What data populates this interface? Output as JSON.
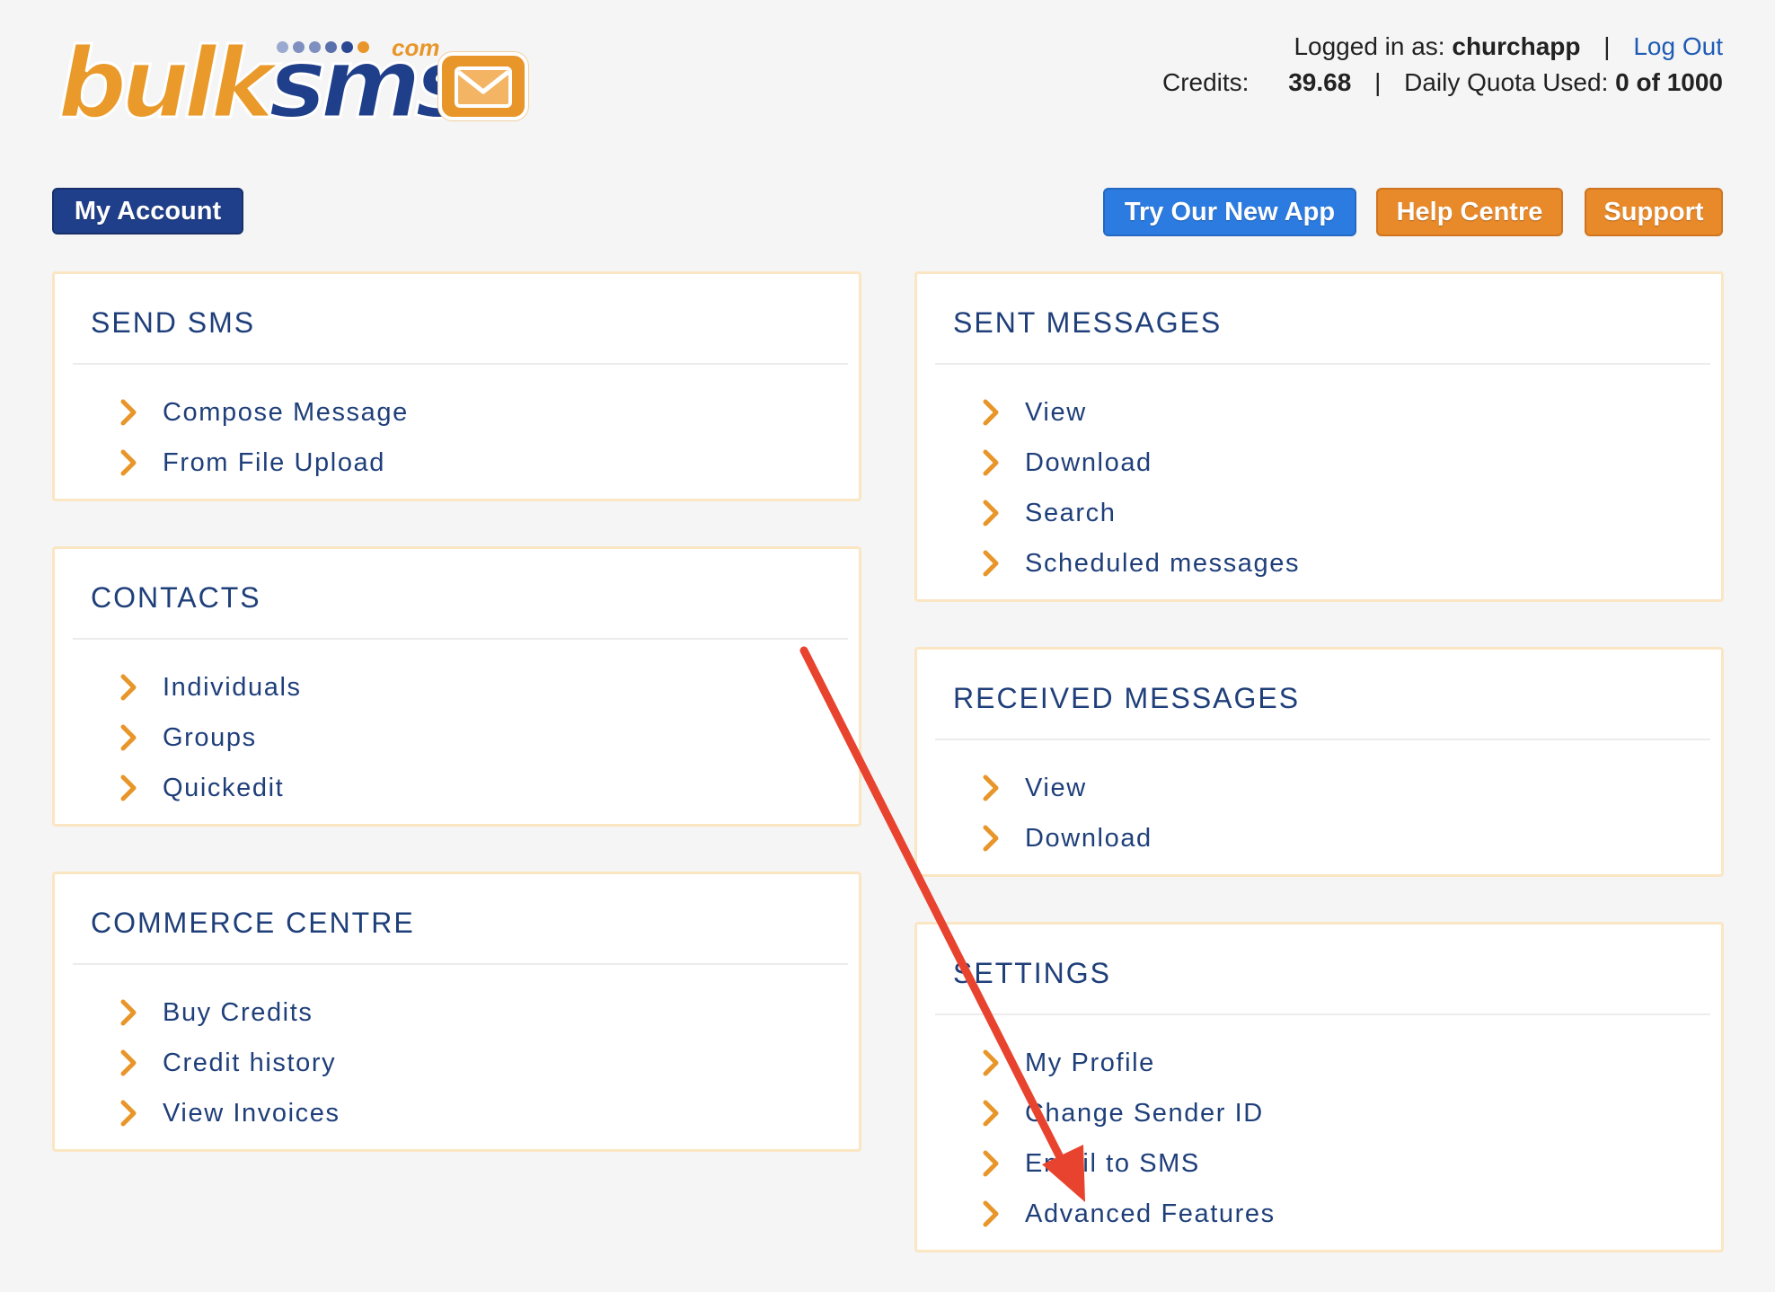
{
  "logo": {
    "part1": "bulk",
    "part2": "sms",
    "domain": "com"
  },
  "user": {
    "logged_in_label": "Logged in as:",
    "username": "churchapp",
    "separator": "|",
    "logout": "Log Out",
    "credits_label": "Credits:",
    "credits_value": "39.68",
    "quota_label": "Daily Quota Used:",
    "quota_value": "0 of 1000"
  },
  "buttons": {
    "my_account": "My Account",
    "try_app": "Try Our New App",
    "help_centre": "Help Centre",
    "support": "Support"
  },
  "panels": {
    "send_sms": {
      "title": "SEND SMS",
      "items": [
        "Compose Message",
        "From File Upload"
      ]
    },
    "contacts": {
      "title": "CONTACTS",
      "items": [
        "Individuals",
        "Groups",
        "Quickedit"
      ]
    },
    "commerce": {
      "title": "COMMERCE CENTRE",
      "items": [
        "Buy Credits",
        "Credit history",
        "View Invoices"
      ]
    },
    "sent": {
      "title": "SENT MESSAGES",
      "items": [
        "View",
        "Download",
        "Search",
        "Scheduled messages"
      ]
    },
    "received": {
      "title": "RECEIVED MESSAGES",
      "items": [
        "View",
        "Download"
      ]
    },
    "settings": {
      "title": "SETTINGS",
      "items": [
        "My Profile",
        "Change Sender ID",
        "Email to SMS",
        "Advanced Features"
      ]
    }
  },
  "colors": {
    "navy": "#1f3f8a",
    "orange": "#e8892a",
    "blue": "#2c7be0",
    "panel_border": "#fbe6c4",
    "annotation_arrow": "#e8432e"
  },
  "icons": {
    "item_bullet": "chevron-right-icon",
    "logo_mark": "envelope-icon",
    "annotation": "annotation-arrow"
  }
}
